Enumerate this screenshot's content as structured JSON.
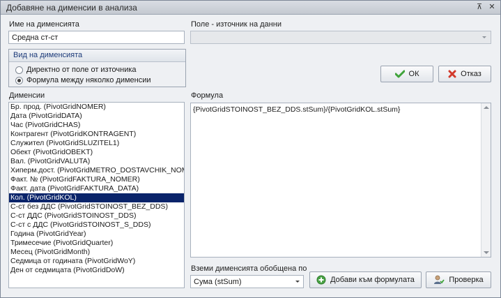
{
  "window": {
    "title": "Добавяне на дименсии в анализа",
    "pin_glyph": "⊼",
    "close_glyph": "✕"
  },
  "dimension_name": {
    "label": "Име на дименсията",
    "value": "Средна ст-ст"
  },
  "source_field": {
    "label": "Поле - източник на данни",
    "value": ""
  },
  "dimension_type": {
    "label": "Вид на дименсията",
    "options": [
      {
        "label": "Директно от поле от източника",
        "checked": false
      },
      {
        "label": "Формула между няколко дименсии",
        "checked": true
      }
    ]
  },
  "buttons": {
    "ok": "ОК",
    "cancel": "Отказ",
    "add_to_formula": "Добави към формулата",
    "check": "Проверка"
  },
  "dimensions": {
    "label": "Дименсии",
    "selected_index": 10,
    "items": [
      "Бр. прод. (PivotGridNOMER)",
      "Дата (PivotGridDATA)",
      "Час (PivotGridCHAS)",
      "Контрагент (PivotGridKONTRAGENT)",
      "Служител (PivotGridSLUZITEL1)",
      "Обект (PivotGridOBEKT)",
      "Вал. (PivotGridVALUTA)",
      "Хиперм.дост. (PivotGridMETRO_DOSTAVCHIK_NOM",
      "Факт. № (PivotGridFAKTURA_NOMER)",
      "Факт. дата (PivotGridFAKTURA_DATA)",
      "Кол. (PivotGridKOL)",
      "С-ст без ДДС (PivotGridSTOINOST_BEZ_DDS)",
      "С-ст ДДС (PivotGridSTOINOST_DDS)",
      "С-ст с ДДС (PivotGridSTOINOST_S_DDS)",
      "Година (PivotGridYear)",
      "Тримесечие (PivotGridQuarter)",
      "Месец (PivotGridMonth)",
      "Седмица от годината (PivotGridWoY)",
      "Ден от седмицата (PivotGridDoW)"
    ]
  },
  "formula": {
    "label": "Формула",
    "value": "{PivotGridSTOINOST_BEZ_DDS.stSum}/{PivotGridKOL.stSum}"
  },
  "aggregation": {
    "label": "Вземи дименсията обобщена по",
    "value": "Сума (stSum)"
  },
  "colors": {
    "selection": "#0a246a",
    "ok_check": "#3fa33a",
    "cancel_x": "#d23a2c",
    "add_plus": "#4aa346"
  }
}
